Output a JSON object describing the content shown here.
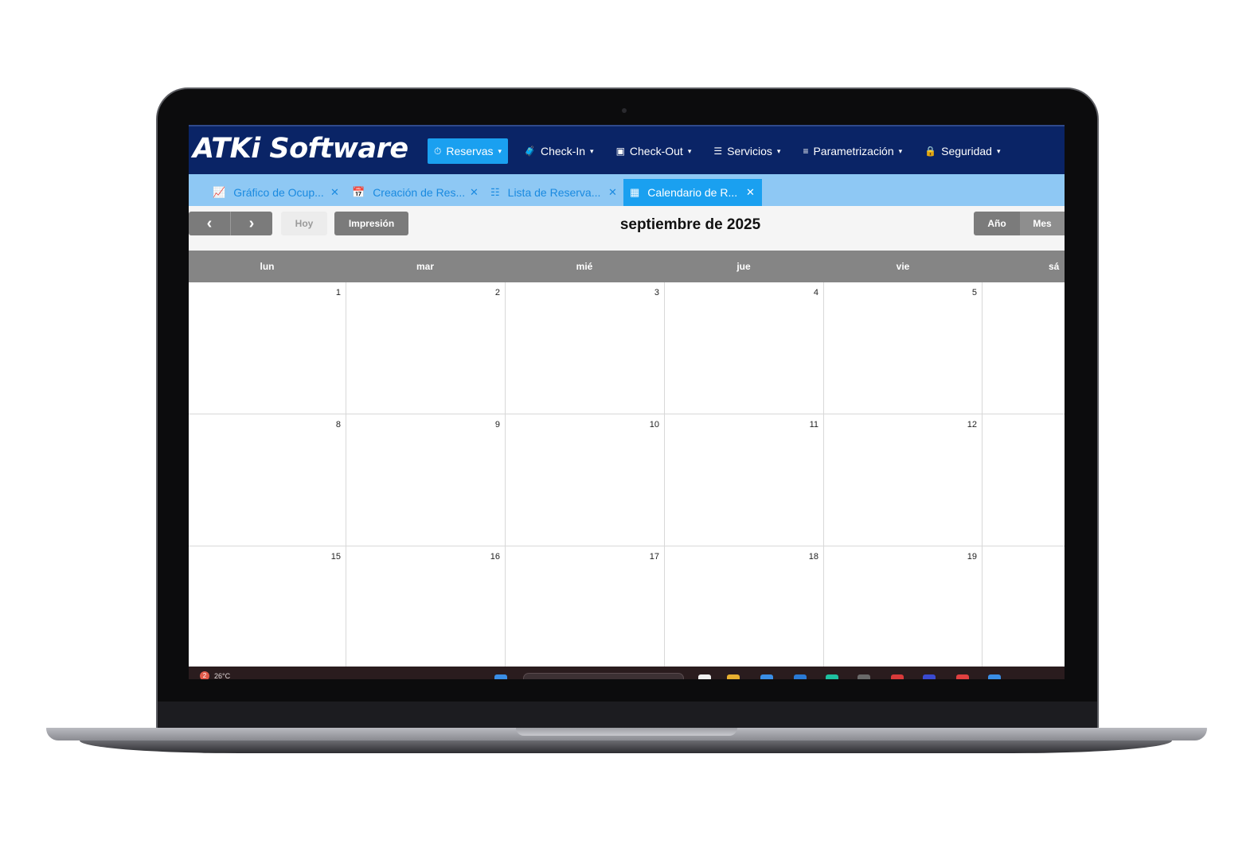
{
  "app": {
    "logo_text": "ATKi Software"
  },
  "nav": {
    "items": [
      {
        "label": "Reservas",
        "icon": "stopwatch-icon"
      },
      {
        "label": "Check-In",
        "icon": "luggage-icon"
      },
      {
        "label": "Check-Out",
        "icon": "id-card-icon"
      },
      {
        "label": "Servicios",
        "icon": "server-icon"
      },
      {
        "label": "Parametrización",
        "icon": "sliders-icon"
      },
      {
        "label": "Seguridad",
        "icon": "lock-icon"
      }
    ],
    "active": "Reservas"
  },
  "tabs": [
    {
      "label": "Gráfico de Ocup...",
      "icon": "line-chart-icon"
    },
    {
      "label": "Creación de Res...",
      "icon": "calendar-check-icon"
    },
    {
      "label": "Lista de Reserva...",
      "icon": "list-icon"
    },
    {
      "label": "Calendario de R...",
      "icon": "calendar-icon"
    }
  ],
  "toolbar": {
    "prev_label": "‹",
    "next_label": "›",
    "today_label": "Hoy",
    "print_label": "Impresión",
    "title": "septiembre de 2025",
    "year_label": "Año",
    "month_label": "Mes"
  },
  "calendar": {
    "day_names": [
      "lun",
      "mar",
      "mié",
      "jue",
      "vie",
      "sá"
    ],
    "weeks": [
      [
        "1",
        "2",
        "3",
        "4",
        "5"
      ],
      [
        "8",
        "9",
        "10",
        "11",
        "12"
      ],
      [
        "15",
        "16",
        "17",
        "18",
        "19"
      ]
    ]
  },
  "taskbar": {
    "weather_badge": "2",
    "weather_temp": "26°C"
  },
  "colors": {
    "topbar": "#0a2466",
    "accent": "#1aa0f0",
    "tabbar": "#8ec8f4",
    "header_gray": "#858585"
  }
}
